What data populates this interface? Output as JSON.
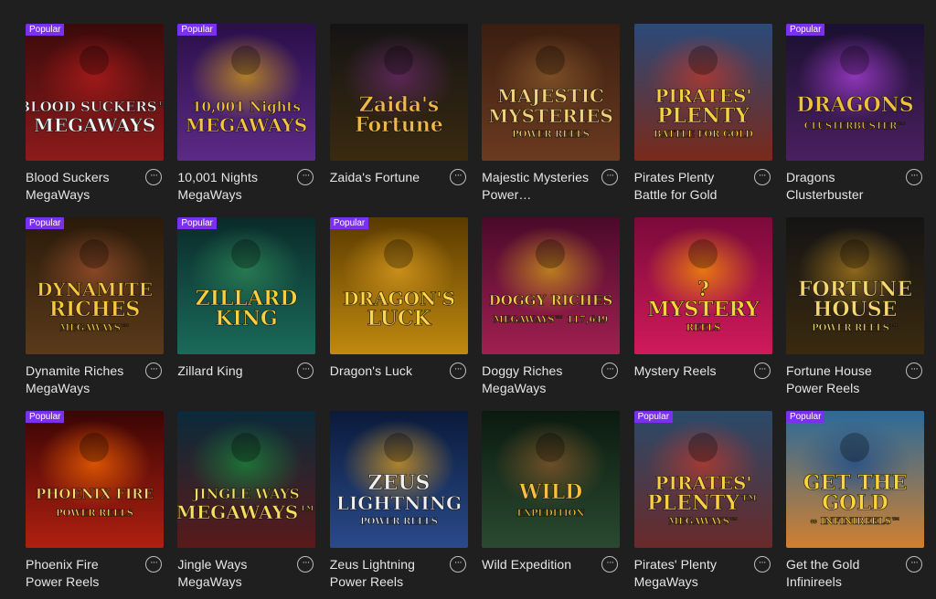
{
  "badge_label": "Popular",
  "more_glyph": "···",
  "games": [
    {
      "title": "Blood Suckers MegaWays",
      "popular": true,
      "logo": [
        "BLOOD SUCKERS™",
        "MEGAWAYS"
      ],
      "bg": [
        "#3b0a0a",
        "#8c1b1b"
      ],
      "text": "#f2f2f2",
      "accent": "#b71c1c"
    },
    {
      "title": "10,001 Nights MegaWays",
      "popular": true,
      "logo": [
        "10,001 Nights",
        "MEGAWAYS"
      ],
      "bg": [
        "#2a0f4a",
        "#5c2a86"
      ],
      "text": "#f5c542",
      "accent": "#d4a017"
    },
    {
      "title": "Zaida's Fortune",
      "popular": false,
      "logo": [
        "Zaida's",
        "Fortune"
      ],
      "bg": [
        "#141414",
        "#3a2a10"
      ],
      "text": "#f0b84a",
      "accent": "#6b2a6b"
    },
    {
      "title": "Majestic Mysteries Power…",
      "popular": false,
      "logo": [
        "MAJESTIC",
        "MYSTERIES",
        "POWER REELS"
      ],
      "bg": [
        "#3a1e10",
        "#6b3a20"
      ],
      "text": "#f2d27a",
      "accent": "#8a5a2a"
    },
    {
      "title": "Pirates Plenty Battle for Gold",
      "popular": false,
      "logo": [
        "PIRATES'",
        "PLENTY",
        "BATTLE FOR GOLD"
      ],
      "bg": [
        "#2a4a7a",
        "#7a2a1a"
      ],
      "text": "#f7d046",
      "accent": "#c0392b"
    },
    {
      "title": "Dragons Clusterbuster",
      "popular": true,
      "logo": [
        "DRAGONS",
        "CLUSTERBUSTER™"
      ],
      "bg": [
        "#1a1030",
        "#4a2060"
      ],
      "text": "#f0c040",
      "accent": "#b040e0"
    },
    {
      "title": "Dynamite Riches MegaWays",
      "popular": true,
      "logo": [
        "DYNAMITE",
        "RICHES",
        "MEGAWAYS™"
      ],
      "bg": [
        "#2a1a0a",
        "#5a3a1a"
      ],
      "text": "#f7c840",
      "accent": "#a0522d"
    },
    {
      "title": "Zillard King",
      "popular": true,
      "logo": [
        "ZILLARD",
        "KING"
      ],
      "bg": [
        "#0a2a2a",
        "#1a6a5a"
      ],
      "text": "#f5d040",
      "accent": "#2e8b57"
    },
    {
      "title": "Dragon's Luck",
      "popular": true,
      "logo": [
        "DRAGON'S",
        "LUCK"
      ],
      "bg": [
        "#5a3a00",
        "#c08a10"
      ],
      "text": "#ffd54a",
      "accent": "#e0a020"
    },
    {
      "title": "Doggy Riches MegaWays",
      "popular": false,
      "logo": [
        "DOGGY RICHES",
        "MEGAWAYS™ 117,649"
      ],
      "bg": [
        "#4a0a2a",
        "#a02050"
      ],
      "text": "#f7d046",
      "accent": "#d4a017"
    },
    {
      "title": "Mystery Reels",
      "popular": false,
      "logo": [
        "?",
        "MYSTERY",
        "REELS"
      ],
      "bg": [
        "#7a0a3a",
        "#d01a5a"
      ],
      "text": "#ffd43a",
      "accent": "#ff9a00"
    },
    {
      "title": "Fortune House Power Reels",
      "popular": false,
      "logo": [
        "FORTUNE",
        "HOUSE",
        "POWER REELS™"
      ],
      "bg": [
        "#141414",
        "#3a2a10"
      ],
      "text": "#f7d870",
      "accent": "#b08020"
    },
    {
      "title": "Phoenix Fire Power Reels",
      "popular": true,
      "logo": [
        "PHOENIX FIRE",
        "POWER REELS"
      ],
      "bg": [
        "#3a0505",
        "#b02010"
      ],
      "text": "#ffd870",
      "accent": "#ff6a00"
    },
    {
      "title": "Jingle Ways MegaWays",
      "popular": false,
      "logo": [
        "JINGLE WAYS",
        "MEGAWAYS™"
      ],
      "bg": [
        "#0a2a3a",
        "#5a1a1a"
      ],
      "text": "#f7e060",
      "accent": "#1a8a3a"
    },
    {
      "title": "Zeus Lightning Power Reels",
      "popular": false,
      "logo": [
        "ZEUS",
        "LIGHTNING",
        "POWER REELS"
      ],
      "bg": [
        "#0a1a3a",
        "#2a4a8a"
      ],
      "text": "#f0f0f0",
      "accent": "#e0a020"
    },
    {
      "title": "Wild Expedition",
      "popular": false,
      "logo": [
        "WILD",
        "EXPEDITION"
      ],
      "bg": [
        "#0a1a10",
        "#2a4a30"
      ],
      "text": "#f7c040",
      "accent": "#8a5a2a"
    },
    {
      "title": "Pirates' Plenty MegaWays",
      "popular": true,
      "logo": [
        "PIRATES'",
        "PLENTY™",
        "MEGAWAYS™"
      ],
      "bg": [
        "#2a4a6a",
        "#6a2a2a"
      ],
      "text": "#f7d046",
      "accent": "#c0392b"
    },
    {
      "title": "Get the Gold Infinireels",
      "popular": true,
      "logo": [
        "GET THE",
        "GOLD",
        "∞ INFINIREELS™"
      ],
      "bg": [
        "#2a6a9a",
        "#d08030"
      ],
      "text": "#ffd43a",
      "accent": "#1a4a8a"
    }
  ]
}
